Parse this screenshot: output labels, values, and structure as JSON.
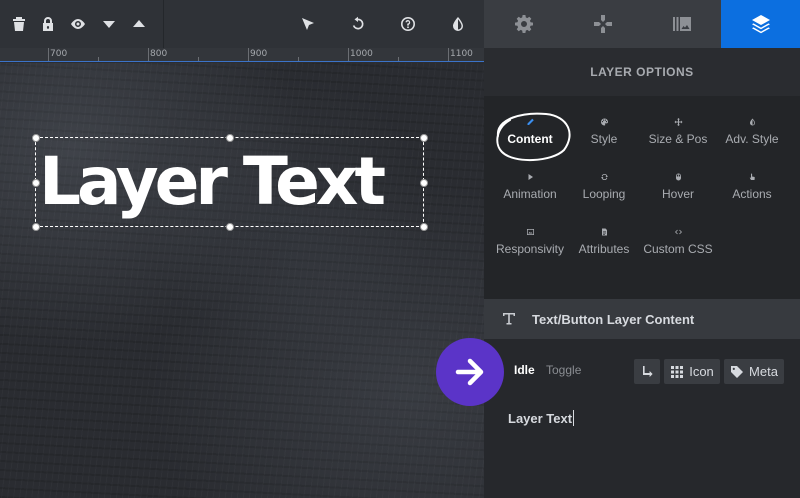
{
  "ruler": {
    "labels": [
      "700",
      "800",
      "900",
      "1000",
      "1100"
    ]
  },
  "canvas": {
    "layer_text": "Layer Text"
  },
  "panel": {
    "header": "LAYER OPTIONS",
    "options": [
      {
        "label": "Content",
        "icon": "pencil-icon",
        "active": true
      },
      {
        "label": "Style",
        "icon": "palette-icon"
      },
      {
        "label": "Size & Pos",
        "icon": "move-icon"
      },
      {
        "label": "Adv. Style",
        "icon": "contrast-icon"
      },
      {
        "label": "Animation",
        "icon": "play-icon"
      },
      {
        "label": "Looping",
        "icon": "loop-icon"
      },
      {
        "label": "Hover",
        "icon": "mouse-icon"
      },
      {
        "label": "Actions",
        "icon": "pointer-hand-icon"
      },
      {
        "label": "Responsivity",
        "icon": "image-frame-icon"
      },
      {
        "label": "Attributes",
        "icon": "document-icon"
      },
      {
        "label": "Custom CSS",
        "icon": "code-icon"
      }
    ],
    "section_title": "Text/Button Layer Content",
    "states": {
      "idle": "Idle",
      "toggle": "Toggle"
    },
    "buttons": {
      "icon": "Icon",
      "meta": "Meta"
    },
    "text_value": "Layer Text"
  },
  "colors": {
    "accent": "#0c6fe0",
    "arrow_badge": "#5b34c8"
  }
}
